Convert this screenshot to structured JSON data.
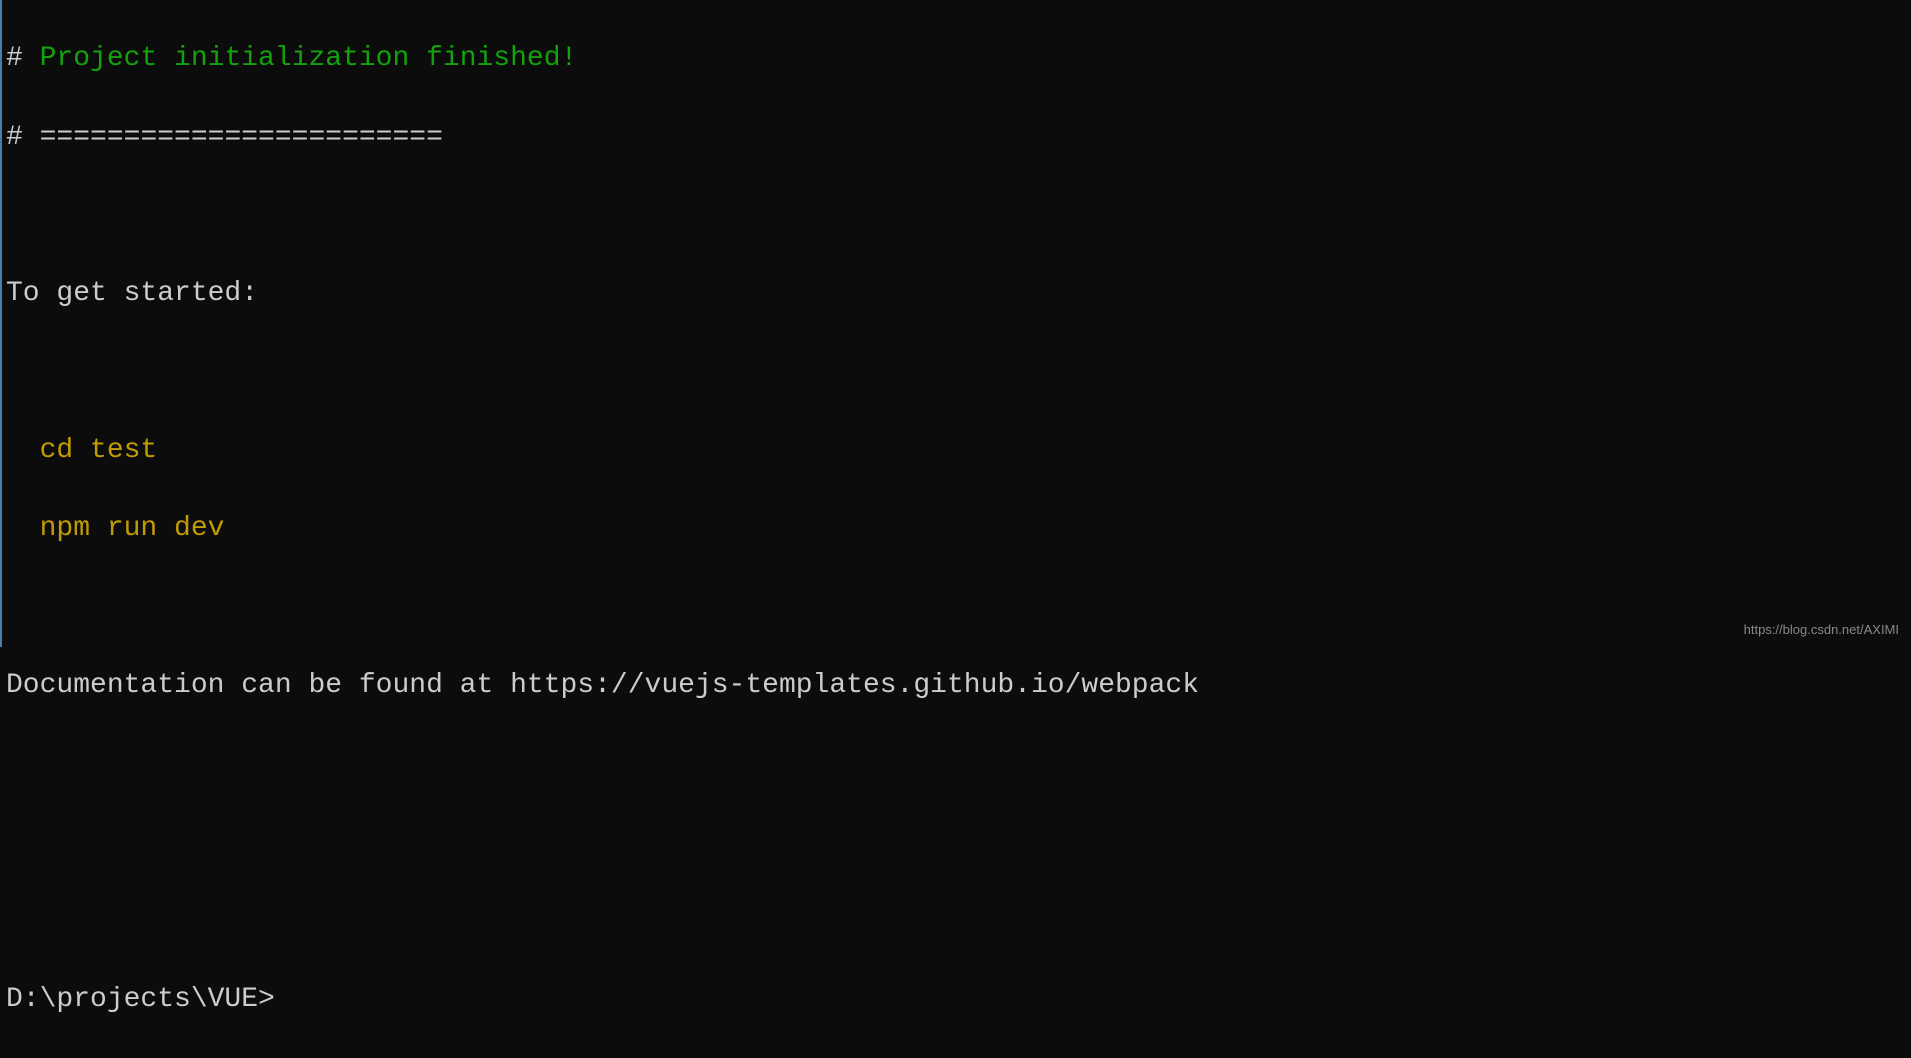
{
  "header": {
    "hash1": "#",
    "title": "Project initialization finished!",
    "hash2": "#",
    "separator": "========================"
  },
  "getStarted": {
    "label": "To get started:",
    "cmd1": "cd test",
    "cmd2": "npm run dev"
  },
  "docs": {
    "prefix": "Documentation can be found at ",
    "url": "https://vuejs-templates.github.io/webpack"
  },
  "prompt": "D:\\projects\\VUE>",
  "watermark": "https://blog.csdn.net/AXIMI"
}
